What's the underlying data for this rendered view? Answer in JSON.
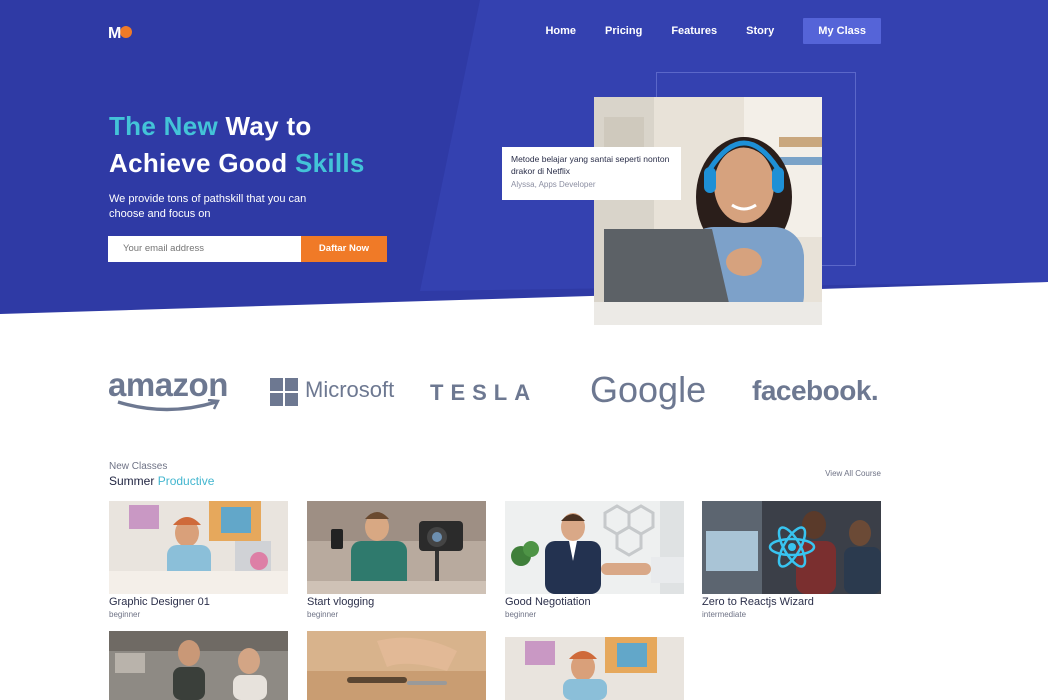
{
  "header": {
    "logo_text": "M",
    "nav": [
      {
        "label": "Home"
      },
      {
        "label": "Pricing"
      },
      {
        "label": "Features"
      },
      {
        "label": "Story"
      },
      {
        "label": "My Class"
      }
    ]
  },
  "hero": {
    "title_part1": "The New",
    "title_part2": " Way to",
    "title_part3": "Achieve Good ",
    "title_part4": "Skills",
    "subtitle": "We provide tons of pathskill that you can choose and focus on",
    "email_placeholder": "Your email address",
    "cta_label": "Daftar Now",
    "testimonial_quote": "Metode belajar yang santai seperti nonton drakor di Netflix",
    "testimonial_author": "Alyssa, Apps Developer"
  },
  "brands": [
    "amazon",
    "Microsoft",
    "TESLA",
    "Google",
    "facebook."
  ],
  "classes": {
    "kicker": "New Classes",
    "title_part1": "Summer ",
    "title_part2": "Productive",
    "view_all": "View All Course",
    "items": [
      {
        "name": "Graphic Designer 01",
        "level": "beginner"
      },
      {
        "name": "Start vlogging",
        "level": "beginner"
      },
      {
        "name": "Good Negotiation",
        "level": "beginner"
      },
      {
        "name": "Zero to Reactjs Wizard",
        "level": "intermediate"
      }
    ]
  },
  "colors": {
    "hero_bg": "#2f3aa5",
    "accent_cyan": "#43c3d8",
    "cta_orange": "#f07a27",
    "nav_active": "#5564d8"
  }
}
